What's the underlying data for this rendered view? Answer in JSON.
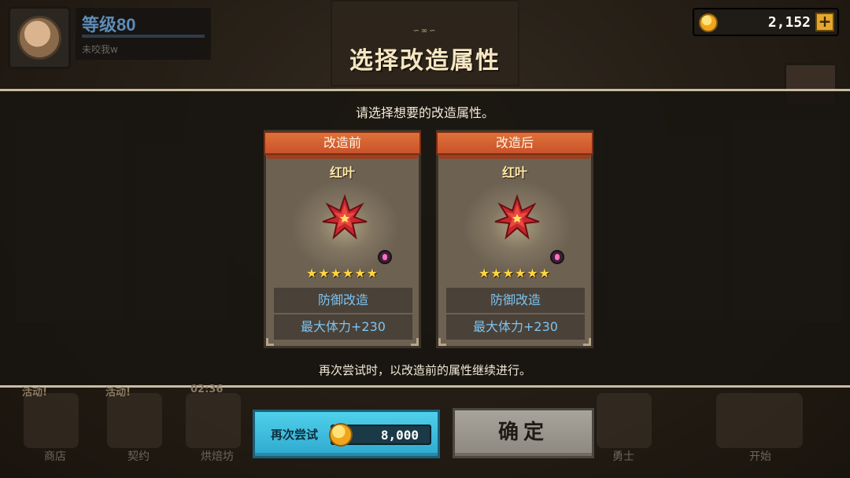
{
  "hud": {
    "level_text": "等级80",
    "level_sub": "未咬我w",
    "level_progress": 0.0,
    "coins": "2,152",
    "plus_symbol": "+"
  },
  "modal": {
    "title": "选择改造属性",
    "ornament": "∽∞∽",
    "instruction": "请选择想要的改造属性。",
    "note": "再次尝试时，以改造前的属性继续进行。"
  },
  "cards": {
    "before": {
      "header": "改造前",
      "item_name": "红叶",
      "stars": "★★★★★★",
      "star_count": 6,
      "stat_type": "防御改造",
      "stat_value": "最大体力+230"
    },
    "after": {
      "header": "改造后",
      "item_name": "红叶",
      "stars": "★★★★★★",
      "star_count": 6,
      "stat_type": "防御改造",
      "stat_value": "最大体力+230"
    }
  },
  "buttons": {
    "retry_label": "再次尝试",
    "retry_cost": "8,000",
    "confirm_label": "确定"
  },
  "bottom_bar": {
    "badges": [
      "活动!",
      "活动!",
      "02:36"
    ],
    "labels": [
      "商店",
      "契约",
      "烘焙坊",
      "勇士",
      "开始"
    ]
  },
  "colors": {
    "ribbon": "#d55f2f",
    "stat_text": "#7cc4f2",
    "retry_button": "#3fbfe0",
    "confirm_button": "#9a968e",
    "title_text": "#f6e7c3"
  }
}
